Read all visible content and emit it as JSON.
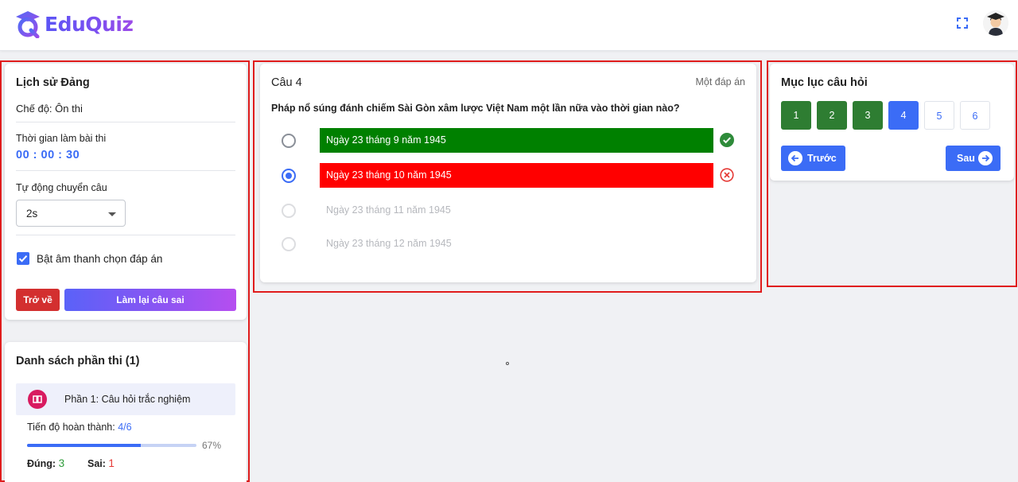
{
  "header": {
    "brand": "EduQuiz",
    "icons": [
      "logo-icon",
      "fullscreen-icon",
      "user-avatar"
    ]
  },
  "settings": {
    "title": "Lịch sử Đảng",
    "mode": "Chế độ: Ôn thi",
    "time_label": "Thời gian làm bài thi",
    "time_value": "00 : 00 : 30",
    "auto_label": "Tự động chuyển câu",
    "auto_value": "2s",
    "sound_label": "Bật âm thanh chọn đáp án",
    "sound_checked": true,
    "back_label": "Trở về",
    "redo_label": "Làm lại câu sai"
  },
  "sections": {
    "title": "Danh sách phần thi (1)",
    "item_label": "Phần 1: Câu hỏi trắc nghiệm",
    "progress_label": "Tiến độ hoàn thành:",
    "progress_value": "4/6",
    "progress_fraction": 0.67,
    "progress_percent": "67%",
    "correct_label": "Đúng:",
    "correct_value": "3",
    "wrong_label": "Sai:",
    "wrong_value": "1"
  },
  "question": {
    "number": "Câu 4",
    "type": "Một đáp án",
    "text": "Pháp nổ súng đánh chiếm Sài Gòn xâm lược Việt Nam một lần nữa vào thời gian nào?",
    "options": [
      {
        "label": "Ngày 23 tháng 9 năm 1945",
        "state": "correct"
      },
      {
        "label": "Ngày 23 tháng 10 năm 1945",
        "state": "wrong-selected"
      },
      {
        "label": "Ngày 23 tháng 11 năm 1945",
        "state": "disabled"
      },
      {
        "label": "Ngày 23 tháng 12 năm 1945",
        "state": "disabled"
      }
    ]
  },
  "index": {
    "title": "Mục lục câu hỏi",
    "items": [
      {
        "label": "1",
        "state": "done"
      },
      {
        "label": "2",
        "state": "done"
      },
      {
        "label": "3",
        "state": "done"
      },
      {
        "label": "4",
        "state": "current"
      },
      {
        "label": "5",
        "state": "todo"
      },
      {
        "label": "6",
        "state": "todo"
      }
    ],
    "prev_label": "Trước",
    "next_label": "Sau"
  },
  "colors": {
    "accent": "#3b6cf6",
    "correct": "#008000",
    "wrong": "#ff0000",
    "done": "#2e7d32",
    "danger": "#d32f2f"
  }
}
